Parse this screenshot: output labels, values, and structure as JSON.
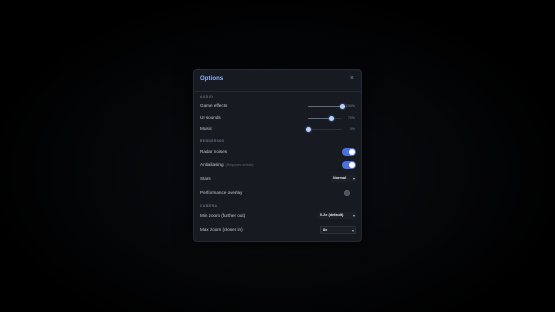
{
  "dialog": {
    "title": "Options",
    "close_glyph": "×"
  },
  "audio": {
    "section_label": "AUDIO",
    "game_effects": {
      "label": "Game effects",
      "value": 1.0,
      "value_text": "100%"
    },
    "ui_sounds": {
      "label": "UI sounds",
      "value": 0.7,
      "value_text": "70%"
    },
    "music": {
      "label": "Music",
      "value": 0.0,
      "value_text": "0%"
    }
  },
  "rendering": {
    "section_label": "RENDERING",
    "radar_noises": {
      "label": "Radar noises",
      "on": true
    },
    "antialiasing": {
      "label": "Antialiasing",
      "sublabel": "(Requires restart)",
      "on": true
    },
    "stars": {
      "label": "Stars",
      "value": "Normal"
    },
    "performance_overlay": {
      "label": "Performance overlay",
      "on": false
    }
  },
  "camera": {
    "section_label": "CAMERA",
    "min_zoom": {
      "label": "Min zoom (further out)",
      "value": "0.2x (default)"
    },
    "max_zoom": {
      "label": "Max zoom (closer in)",
      "value": "8x"
    }
  },
  "colors": {
    "accent": "#8fb6ff",
    "toggle_on": "#4f6fe0",
    "panel": "#171a21"
  },
  "icons": {
    "close": "close-icon",
    "dropdown": "chevron-down-icon"
  }
}
